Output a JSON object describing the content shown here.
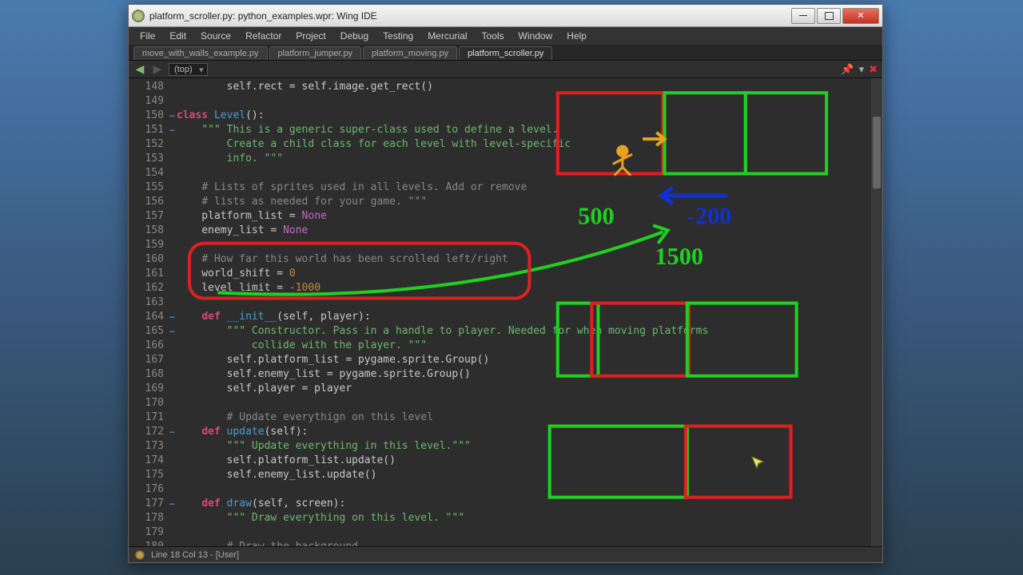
{
  "window": {
    "title": "platform_scroller.py: python_examples.wpr: Wing IDE"
  },
  "menu": [
    "File",
    "Edit",
    "Source",
    "Refactor",
    "Project",
    "Debug",
    "Testing",
    "Mercurial",
    "Tools",
    "Window",
    "Help"
  ],
  "tabs": [
    {
      "label": "move_with_walls_example.py",
      "active": false
    },
    {
      "label": "platform_jumper.py",
      "active": false
    },
    {
      "label": "platform_moving.py",
      "active": false
    },
    {
      "label": "platform_scroller.py",
      "active": true
    }
  ],
  "scope": "(top)",
  "status": "Line 18 Col 13 - [User]",
  "annotations": {
    "n500": "500",
    "n200": "-200",
    "n1500": "1500"
  },
  "lines_start": 148,
  "lines_end": 180,
  "code": [
    {
      "n": 148,
      "indent": 8,
      "html": "self.rect = self.image.get_rect()"
    },
    {
      "n": 149,
      "indent": 0,
      "html": ""
    },
    {
      "n": 150,
      "indent": 0,
      "fold": true,
      "html": "<span class='kw'>class</span> <span class='cls'>Level</span>():"
    },
    {
      "n": 151,
      "indent": 4,
      "fold": true,
      "html": "<span class='str'>\"\"\" This is a generic super-class used to define a level.</span>"
    },
    {
      "n": 152,
      "indent": 8,
      "html": "<span class='str'>Create a child class for each level with level-specific</span>"
    },
    {
      "n": 153,
      "indent": 8,
      "html": "<span class='str'>info. \"\"\"</span>"
    },
    {
      "n": 154,
      "indent": 0,
      "html": ""
    },
    {
      "n": 155,
      "indent": 4,
      "html": "<span class='cmt'># Lists of sprites used in all levels. Add or remove</span>"
    },
    {
      "n": 156,
      "indent": 4,
      "html": "<span class='cmt'># lists as needed for your game. \"\"\"</span>"
    },
    {
      "n": 157,
      "indent": 4,
      "html": "platform_list = <span class='none'>None</span>"
    },
    {
      "n": 158,
      "indent": 4,
      "html": "enemy_list = <span class='none'>None</span>"
    },
    {
      "n": 159,
      "indent": 0,
      "html": ""
    },
    {
      "n": 160,
      "indent": 4,
      "html": "<span class='cmt'># How far this world has been scrolled left/right</span>"
    },
    {
      "n": 161,
      "indent": 4,
      "html": "world_shift = <span class='num'>0</span>"
    },
    {
      "n": 162,
      "indent": 4,
      "html": "level_limit = <span class='num'>-1000</span>"
    },
    {
      "n": 163,
      "indent": 0,
      "html": ""
    },
    {
      "n": 164,
      "indent": 4,
      "fold": true,
      "html": "<span class='kw'>def</span> <span class='fn'>__init__</span>(self, player):"
    },
    {
      "n": 165,
      "indent": 8,
      "fold": true,
      "html": "<span class='str'>\"\"\" Constructor. Pass in a handle to player. Needed for when moving platforms</span>"
    },
    {
      "n": 166,
      "indent": 12,
      "html": "<span class='str'>collide with the player. \"\"\"</span>"
    },
    {
      "n": 167,
      "indent": 8,
      "html": "self.platform_list = pygame.sprite.Group()"
    },
    {
      "n": 168,
      "indent": 8,
      "html": "self.enemy_list = pygame.sprite.Group()"
    },
    {
      "n": 169,
      "indent": 8,
      "html": "self.player = player"
    },
    {
      "n": 170,
      "indent": 0,
      "html": ""
    },
    {
      "n": 171,
      "indent": 8,
      "html": "<span class='cmt'># Update everythign on this level</span>"
    },
    {
      "n": 172,
      "indent": 4,
      "fold": true,
      "html": "<span class='kw'>def</span> <span class='fn'>update</span>(self):"
    },
    {
      "n": 173,
      "indent": 8,
      "html": "<span class='str'>\"\"\" Update everything in this level.\"\"\"</span>"
    },
    {
      "n": 174,
      "indent": 8,
      "html": "self.platform_list.update()"
    },
    {
      "n": 175,
      "indent": 8,
      "html": "self.enemy_list.update()"
    },
    {
      "n": 176,
      "indent": 0,
      "html": ""
    },
    {
      "n": 177,
      "indent": 4,
      "fold": true,
      "html": "<span class='kw'>def</span> <span class='fn'>draw</span>(self, screen):"
    },
    {
      "n": 178,
      "indent": 8,
      "html": "<span class='str'>\"\"\" Draw everything on this level. \"\"\"</span>"
    },
    {
      "n": 179,
      "indent": 0,
      "html": ""
    },
    {
      "n": 180,
      "indent": 8,
      "html": "<span class='cmt'># Draw the background</span>"
    }
  ]
}
